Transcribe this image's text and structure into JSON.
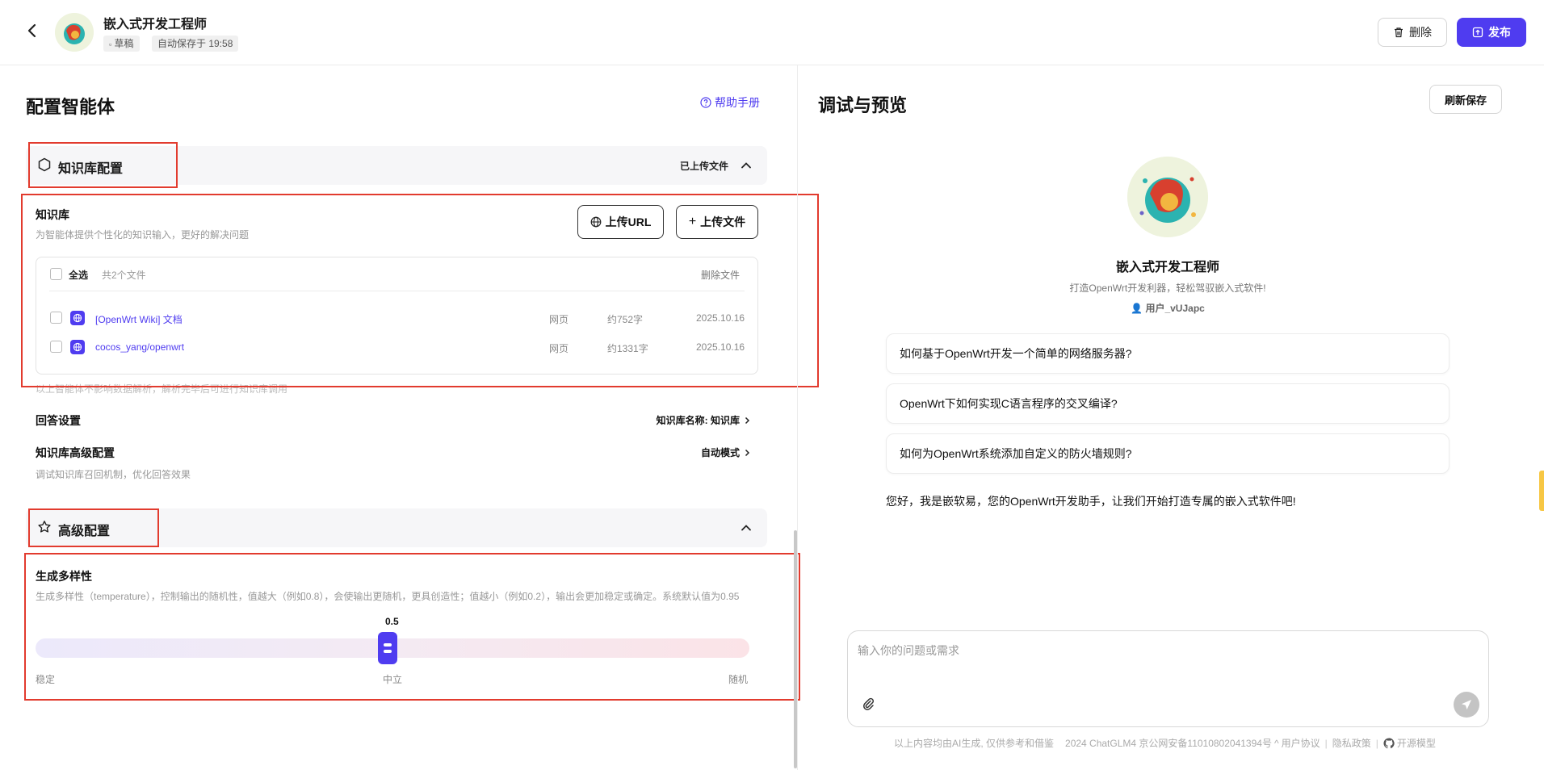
{
  "header": {
    "title": "嵌入式开发工程师",
    "draft_tag": "草稿",
    "autosave_tag": "自动保存于 19:58",
    "delete_label": "删除",
    "publish_label": "发布"
  },
  "config": {
    "title": "配置智能体",
    "help_label": "帮助手册",
    "knowledge_section": {
      "title": "知识库配置",
      "right_label": "已上传文件",
      "kb_label": "知识库",
      "kb_desc": "为智能体提供个性化的知识输入，更好的解决问题",
      "upload_url_label": "上传URL",
      "upload_file_label": "上传文件",
      "table": {
        "select_all_label": "全选",
        "count_label": "共2个文件",
        "delete_files_label": "删除文件",
        "rows": [
          {
            "name": "[OpenWrt Wiki] 文档",
            "type": "网页",
            "size": "约752字",
            "date": "2025.10.16"
          },
          {
            "name": "cocos_yang/openwrt",
            "type": "网页",
            "size": "约1331字",
            "date": "2025.10.16"
          }
        ]
      },
      "note": "以上智能体不影响数据解析，解析完毕后可进行知识库调用"
    },
    "answer_settings": {
      "label": "回答设置",
      "value": "知识库名称: 知识库"
    },
    "advanced_kb": {
      "label": "知识库高级配置",
      "value": "自动模式",
      "desc": "调试知识库召回机制，优化回答效果"
    },
    "advanced_section": {
      "title": "高级配置",
      "temp_label": "生成多样性",
      "temp_desc": "生成多样性（temperature），控制输出的随机性，值越大（例如0.8），会使输出更随机，更具创造性；值越小（例如0.2），输出会更加稳定或确定。系统默认值为0.95",
      "slider_value": "0.5",
      "slider_fraction": 0.5,
      "label_left": "稳定",
      "label_mid": "中立",
      "label_right": "随机"
    }
  },
  "preview": {
    "title": "调试与预览",
    "refresh_label": "刷新保存",
    "agent_name": "嵌入式开发工程师",
    "agent_desc": "打造OpenWrt开发利器，轻松驾驭嵌入式软件!",
    "agent_user": "用户_vUJapc",
    "suggestions": [
      "如何基于OpenWrt开发一个简单的网络服务器?",
      "OpenWrt下如何实现C语言程序的交叉编译?",
      "如何为OpenWrt系统添加自定义的防火墙规则?"
    ],
    "greeting": "您好，我是嵌软易，您的OpenWrt开发助手，让我们开始打造专属的嵌入式软件吧!",
    "input_placeholder": "输入你的问题或需求"
  },
  "footer": {
    "disclaimer": "以上内容均由AI生成, 仅供参考和借鉴",
    "icp": "2024 ChatGLM4 京公网安备11010802041394号",
    "agreement": "用户协议",
    "privacy": "隐私政策",
    "opensource": "开源模型"
  },
  "colors": {
    "accent": "#4f3cf0",
    "highlight_box": "#e23b2e"
  }
}
